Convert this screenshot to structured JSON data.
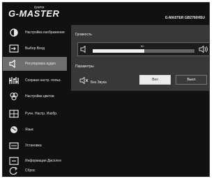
{
  "header": {
    "brand": "G-MASTER",
    "brand_sup": "iiyama",
    "model": "G-MASTER GB2760HSU"
  },
  "sidebar": {
    "items": [
      {
        "label": "Настройка изображения",
        "icon": "image-settings-icon"
      },
      {
        "label": "Выбор Вход",
        "icon": "input-select-icon"
      },
      {
        "label": "Регулировка аудио",
        "icon": "speaker-icon",
        "active": true
      },
      {
        "label": "Сохрани настр. польз.",
        "icon": "user-settings-icon"
      },
      {
        "label": "Настройки цветов",
        "icon": "color-settings-icon"
      },
      {
        "label": "Ручн. Настр. Изобр.",
        "icon": "manual-image-icon"
      },
      {
        "label": "Язык",
        "icon": "globe-icon"
      },
      {
        "label": "Установка",
        "icon": "setup-icon"
      },
      {
        "label": "Информация Дисплея",
        "icon": "info-icon"
      },
      {
        "label": "Сброс",
        "icon": "reset-icon"
      }
    ]
  },
  "audio": {
    "volume_title": "Громкость",
    "volume_value": "50",
    "volume_fraction": 0.51,
    "params_title": "Параметры",
    "mute_label": "Без Звука",
    "on_label": "Вкл",
    "off_label": "Выкл"
  },
  "colors": {
    "active_bg": "#6e6e6e",
    "panel_bg": "#383838",
    "accent_light": "#ececec"
  }
}
